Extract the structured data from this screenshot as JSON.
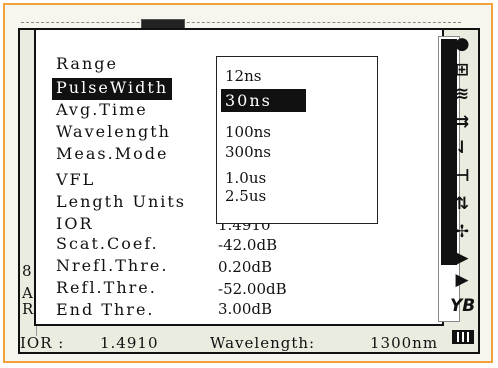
{
  "menu": {
    "items": [
      {
        "label": "Range",
        "value": ""
      },
      {
        "label": "PulseWidth",
        "value": "",
        "selected": true
      },
      {
        "label": "Avg.Time",
        "value": ""
      },
      {
        "label": "Wavelength",
        "value": ""
      },
      {
        "label": "Meas.Mode",
        "value": ""
      },
      {
        "label": "VFL",
        "value": ""
      },
      {
        "label": "Length Units",
        "value": ""
      },
      {
        "label": "IOR",
        "value": "1.4910"
      },
      {
        "label": "Scat.Coef.",
        "value": "-42.0dB"
      },
      {
        "label": "Nrefl.Thre.",
        "value": "0.20dB"
      },
      {
        "label": "Refl.Thre.",
        "value": "-52.00dB"
      },
      {
        "label": "End Thre.",
        "value": "3.00dB"
      }
    ]
  },
  "dropdown": {
    "options": [
      "12ns",
      "30ns",
      "100ns",
      "300ns",
      "1.0us",
      "2.5us"
    ],
    "selected": "30ns"
  },
  "scroll_fraction": 0.8,
  "side_letters": [
    "8",
    "A",
    "R"
  ],
  "statusbar": {
    "ior_label": "IOR :",
    "ior_value": "1.4910",
    "wavelength_label": "Wavelength:",
    "wavelength_value": "1300nm"
  },
  "right_toolbar": {
    "icons": [
      "zoom-icon",
      "grid-icon",
      "trace-icon",
      "align-icon",
      "marker-icon",
      "event-icon",
      "swap-icon",
      "cross-icon",
      "flag-a-icon",
      "flag-b-icon",
      "yb-icon"
    ],
    "yb_label": "YB"
  }
}
